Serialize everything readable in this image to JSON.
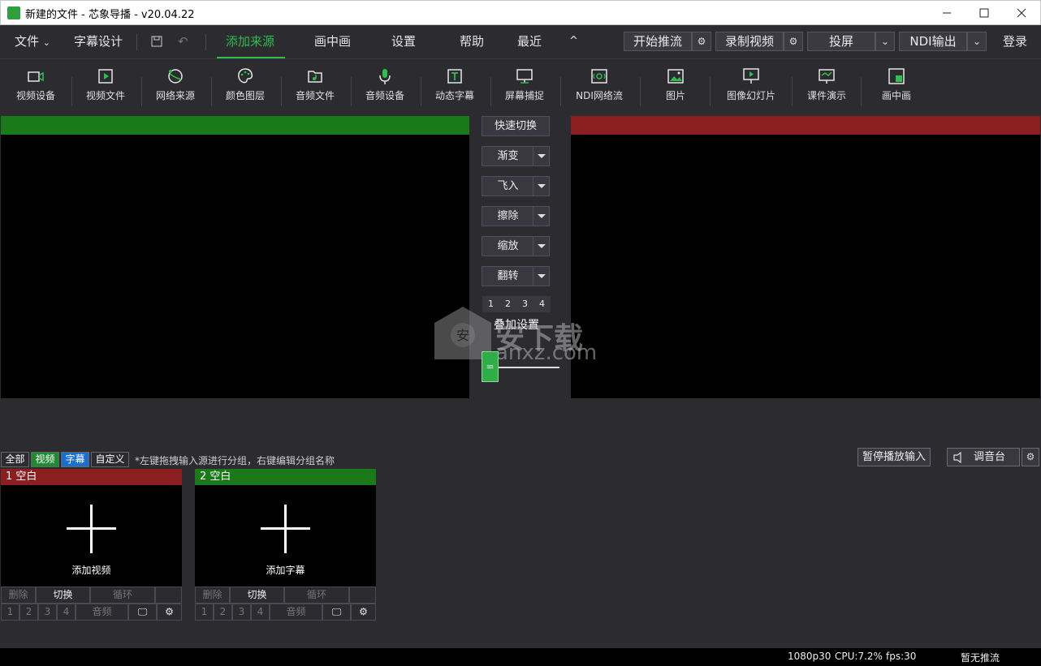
{
  "window": {
    "title": "新建的文件 - 芯象导播 - v20.04.22"
  },
  "menu": {
    "file": "文件",
    "subtitle_design": "字幕设计",
    "add_source": "添加来源",
    "pip": "画中画",
    "settings": "设置",
    "help": "帮助",
    "recent": "最近",
    "start_stream": "开始推流",
    "record": "录制视频",
    "cast": "投屏",
    "ndi_out": "NDI输出",
    "login": "登录"
  },
  "toolbar": [
    {
      "label": "视频设备",
      "icon": "video-device-icon"
    },
    {
      "label": "视频文件",
      "icon": "video-file-icon"
    },
    {
      "label": "网络来源",
      "icon": "network-source-icon"
    },
    {
      "label": "颜色图层",
      "icon": "palette-icon"
    },
    {
      "label": "音频文件",
      "icon": "audio-file-icon"
    },
    {
      "label": "音频设备",
      "icon": "microphone-icon"
    },
    {
      "label": "动态字幕",
      "icon": "text-icon"
    },
    {
      "label": "屏幕捕捉",
      "icon": "monitor-icon"
    },
    {
      "label": "NDI网络流",
      "icon": "ndi-icon"
    },
    {
      "label": "图片",
      "icon": "image-icon"
    },
    {
      "label": "图像幻灯片",
      "icon": "slideshow-icon"
    },
    {
      "label": "课件演示",
      "icon": "presentation-icon"
    },
    {
      "label": "画中画",
      "icon": "pip-icon"
    }
  ],
  "transitions": {
    "quick_switch": "快速切换",
    "items": [
      "渐变",
      "飞入",
      "擦除",
      "缩放",
      "翻转"
    ],
    "numbers": [
      "1",
      "2",
      "3",
      "4"
    ],
    "overlay_settings": "叠加设置",
    "tbar_label": "="
  },
  "groups": {
    "tabs": [
      "全部",
      "视频",
      "字幕",
      "自定义"
    ],
    "hint": "*左键拖拽输入源进行分组，右键编辑分组名称",
    "pause_input": "暂停播放输入",
    "mixer": "调音台"
  },
  "sources": [
    {
      "header": "1 空白",
      "add_label": "添加视频",
      "header_color": "#8b1e1e"
    },
    {
      "header": "2 空白",
      "add_label": "添加字幕",
      "header_color": "#1a7a1a"
    }
  ],
  "source_controls": {
    "delete": "删除",
    "switch": "切换",
    "loop": "循环",
    "nums": [
      "1",
      "2",
      "3",
      "4"
    ],
    "audio": "音频"
  },
  "status": {
    "resolution": "1080p30",
    "cpu": "CPU:7.2%",
    "fps": "fps:30",
    "stream": "暂无推流"
  },
  "watermark": {
    "text_top": "安下载",
    "text_bottom": "anxz.com"
  },
  "colors": {
    "accent": "#2fbf4d",
    "program": "#8b1e1e",
    "preview": "#1a7a1a"
  }
}
